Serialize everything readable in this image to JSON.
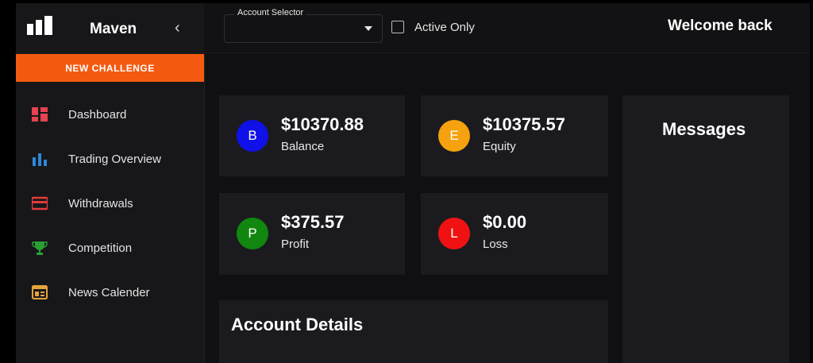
{
  "sidebar": {
    "brand": "Maven",
    "collapse_glyph": "‹",
    "new_challenge": "NEW CHALLENGE",
    "items": [
      {
        "label": "Dashboard",
        "icon": "dashboard-icon",
        "color": "#e4434f"
      },
      {
        "label": "Trading Overview",
        "icon": "bar-chart-icon",
        "color": "#2f86d6"
      },
      {
        "label": "Withdrawals",
        "icon": "card-icon",
        "color": "#e23b3b"
      },
      {
        "label": "Competition",
        "icon": "trophy-icon",
        "color": "#2aa034"
      },
      {
        "label": "News Calender",
        "icon": "calendar-icon",
        "color": "#e7a33c"
      }
    ]
  },
  "topbar": {
    "account_selector_label": "Account Selector",
    "account_selector_value": "",
    "active_only_label": "Active Only",
    "active_only_checked": false,
    "welcome": "Welcome back"
  },
  "stats": [
    {
      "initial": "B",
      "value": "$10370.88",
      "label": "Balance",
      "color": "#1010e8"
    },
    {
      "initial": "E",
      "value": "$10375.57",
      "label": "Equity",
      "color": "#f5a20e"
    },
    {
      "initial": "P",
      "value": "$375.57",
      "label": "Profit",
      "color": "#11870f"
    },
    {
      "initial": "L",
      "value": "$0.00",
      "label": "Loss",
      "color": "#f01212"
    }
  ],
  "messages": {
    "title": "Messages"
  },
  "account_details": {
    "title": "Account Details"
  },
  "colors": {
    "accent": "#f35a10",
    "background": "#101012",
    "card": "#1b1b1f"
  }
}
